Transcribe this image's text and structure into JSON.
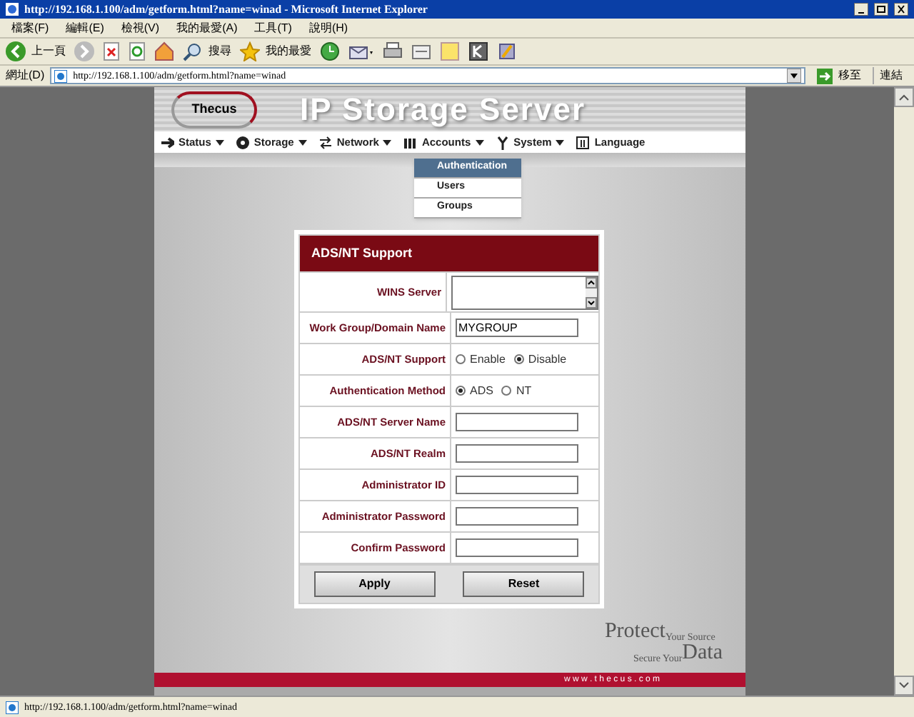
{
  "window": {
    "title": "http://192.168.1.100/adm/getform.html?name=winad - Microsoft Internet Explorer"
  },
  "menu_bar": [
    "檔案(F)",
    "編輯(E)",
    "檢視(V)",
    "我的最愛(A)",
    "工具(T)",
    "說明(H)"
  ],
  "toolbar": {
    "back": "上一頁",
    "search": "搜尋",
    "favorites": "我的最愛"
  },
  "address_bar": {
    "label": "網址(D)",
    "url": "http://192.168.1.100/adm/getform.html?name=winad",
    "go": "移至",
    "links": "連結"
  },
  "page": {
    "logo": "Thecus",
    "banner": "IP Storage Server",
    "nav": [
      {
        "label": "Status",
        "has_menu": true
      },
      {
        "label": "Storage",
        "has_menu": true
      },
      {
        "label": "Network",
        "has_menu": true
      },
      {
        "label": "Accounts",
        "has_menu": true
      },
      {
        "label": "System",
        "has_menu": true
      },
      {
        "label": "Language",
        "has_menu": false
      }
    ],
    "dropdown": [
      {
        "label": "Authentication",
        "selected": true
      },
      {
        "label": "Users",
        "selected": false
      },
      {
        "label": "Groups",
        "selected": false
      }
    ],
    "form": {
      "title": "ADS/NT Support",
      "rows": [
        {
          "kind": "textarea",
          "label": "WINS Server"
        },
        {
          "kind": "text",
          "label": "Work Group/Domain Name",
          "value": "MYGROUP"
        },
        {
          "kind": "radio",
          "label": "ADS/NT Support",
          "options": [
            {
              "label": "Enable",
              "selected": false
            },
            {
              "label": "Disable",
              "selected": true
            }
          ]
        },
        {
          "kind": "radio",
          "label": "Authentication Method",
          "options": [
            {
              "label": "ADS",
              "selected": true
            },
            {
              "label": "NT",
              "selected": false
            }
          ]
        },
        {
          "kind": "text",
          "label": "ADS/NT Server Name"
        },
        {
          "kind": "text",
          "label": "ADS/NT Realm"
        },
        {
          "kind": "text",
          "label": "Administrator ID"
        },
        {
          "kind": "password",
          "label": "Administrator Password"
        },
        {
          "kind": "password",
          "label": "Confirm Password"
        }
      ],
      "buttons": [
        "Apply",
        "Reset"
      ]
    },
    "slogan": {
      "line1": "Protect",
      "line1b": "Your Source",
      "line2a": "Secure Your",
      "line2": "Data"
    },
    "footer": "w w w . t h e c u s . c o m"
  },
  "status_bar": {
    "text": "http://192.168.1.100/adm/getform.html?name=winad"
  }
}
